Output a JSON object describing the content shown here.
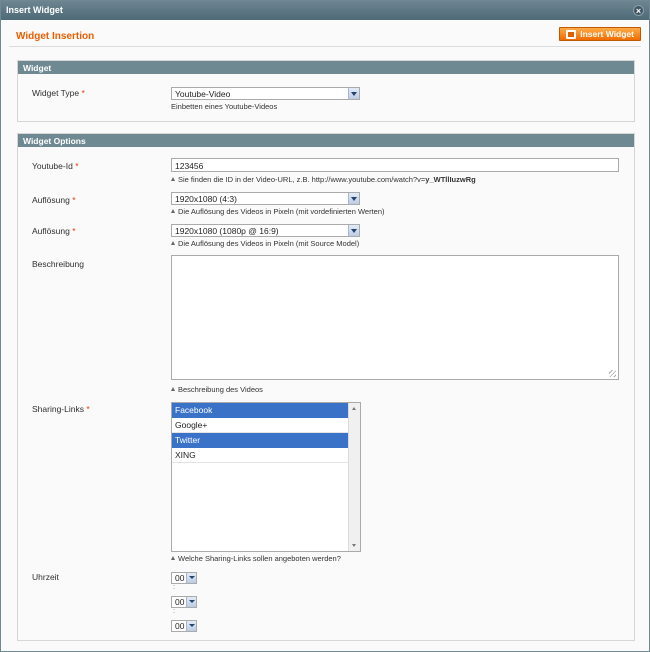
{
  "window": {
    "title": "Insert Widget",
    "close_glyph": "×"
  },
  "header": {
    "title": "Widget Insertion",
    "insert_button_label": "Insert Widget"
  },
  "widget_section": {
    "title": "Widget",
    "type_label": "Widget Type",
    "required_mark": "*",
    "type_value": "Youtube-Video",
    "type_hint": "Einbetten eines Youtube-Videos"
  },
  "options_section": {
    "title": "Widget Options",
    "youtube_id": {
      "label": "Youtube-Id",
      "value": "123456",
      "hint_prefix": "Sie finden die ID in der Video-URL, z.B. http://www.youtube.com/watch?v=",
      "hint_id": "y_WTllIuzwRg"
    },
    "resolution1": {
      "label": "Auflösung",
      "value": "1920x1080 (4:3)",
      "hint": "Die Auflösung des Videos in Pixeln (mit vordefinierten Werten)"
    },
    "resolution2": {
      "label": "Auflösung",
      "value": "1920x1080 (1080p @ 16:9)",
      "hint": "Die Auflösung des Videos in Pixeln (mit Source Model)"
    },
    "description": {
      "label": "Beschreibung",
      "value": "",
      "hint": "Beschreibung des Videos"
    },
    "sharing": {
      "label": "Sharing-Links",
      "options": [
        {
          "label": "Facebook",
          "selected": true
        },
        {
          "label": "Google+",
          "selected": false
        },
        {
          "label": "Twitter",
          "selected": true
        },
        {
          "label": "XING",
          "selected": false
        }
      ],
      "hint": "Welche Sharing-Links sollen angeboten werden?"
    },
    "time": {
      "label": "Uhrzeit",
      "hour": "00",
      "minute": "00",
      "second": "00",
      "separator": ":"
    }
  },
  "colors": {
    "accent_orange": "#eb5e00",
    "section_header": "#6f8992",
    "selected_option": "#3a72c8",
    "required": "#eb340a"
  }
}
